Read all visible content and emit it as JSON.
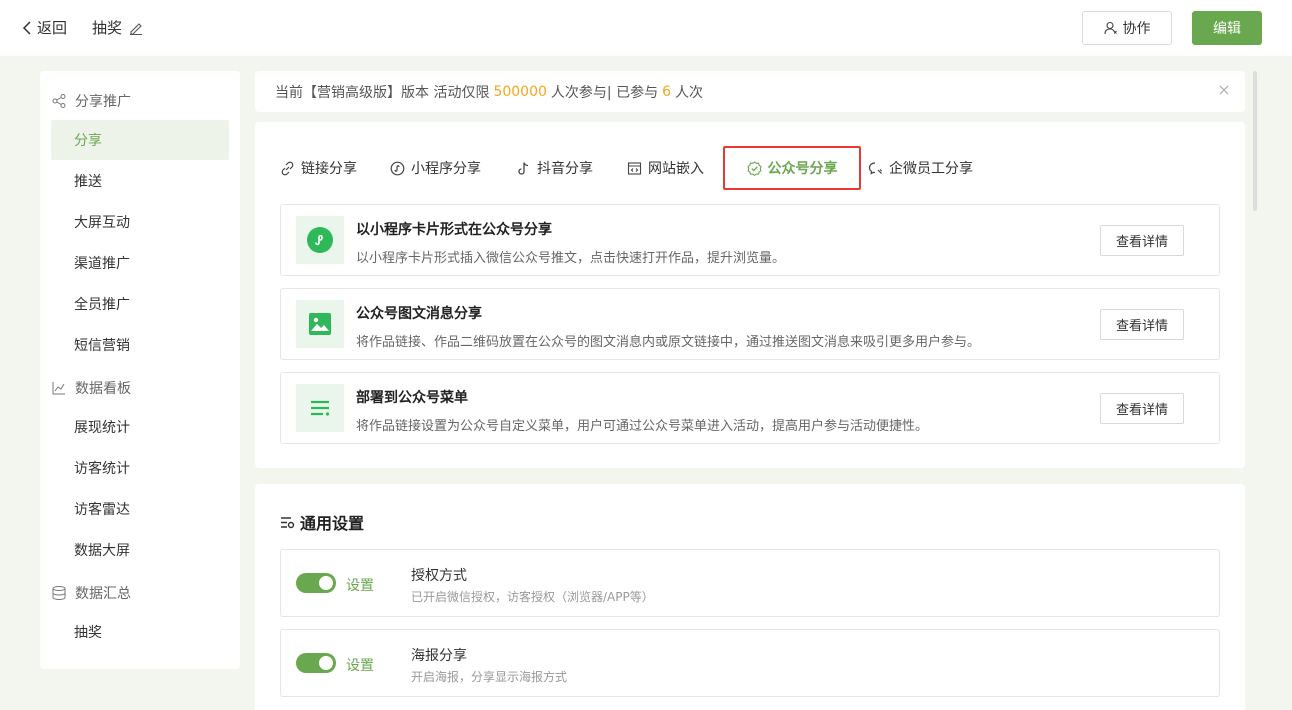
{
  "header": {
    "back_label": "返回",
    "title": "抽奖",
    "collab_label": "协作",
    "edit_label": "编辑"
  },
  "sidebar": {
    "groups": [
      {
        "label": "分享推广",
        "icon": "share-icon",
        "items": [
          "分享",
          "推送",
          "大屏互动",
          "渠道推广",
          "全员推广",
          "短信营销"
        ]
      },
      {
        "label": "数据看板",
        "icon": "chart-icon",
        "items": [
          "展现统计",
          "访客统计",
          "访客雷达",
          "数据大屏"
        ]
      },
      {
        "label": "数据汇总",
        "icon": "database-icon",
        "items": [
          "抽奖"
        ]
      }
    ],
    "active": "分享"
  },
  "notice": {
    "prefix": "当前【营销高级版】版本 活动仅限",
    "limit": "500000",
    "middle": "人次参与| 已参与",
    "count": "6",
    "suffix": "人次"
  },
  "tabs": [
    {
      "label": "链接分享",
      "icon": "link-icon"
    },
    {
      "label": "小程序分享",
      "icon": "miniprogram-icon"
    },
    {
      "label": "抖音分享",
      "icon": "douyin-icon"
    },
    {
      "label": "网站嵌入",
      "icon": "embed-icon"
    },
    {
      "label": "公众号分享",
      "icon": "verified-icon",
      "active": true
    },
    {
      "label": "企微员工分享",
      "icon": "wecom-icon"
    }
  ],
  "cards": [
    {
      "title": "以小程序卡片形式在公众号分享",
      "desc": "以小程序卡片形式插入微信公众号推文，点击快速打开作品，提升浏览量。",
      "button": "查看详情",
      "icon": "miniprogram-circle-icon"
    },
    {
      "title": "公众号图文消息分享",
      "desc": "将作品链接、作品二维码放置在公众号的图文消息内或原文链接中，通过推送图文消息来吸引更多用户参与。",
      "button": "查看详情",
      "icon": "image-icon"
    },
    {
      "title": "部署到公众号菜单",
      "desc": "将作品链接设置为公众号自定义菜单，用户可通过公众号菜单进入活动，提高用户参与活动便捷性。",
      "button": "查看详情",
      "icon": "menu-icon"
    }
  ],
  "settings": {
    "title": "通用设置",
    "rows": [
      {
        "link": "设置",
        "title": "授权方式",
        "desc": "已开启微信授权，访客授权（浏览器/APP等）",
        "enabled": true
      },
      {
        "link": "设置",
        "title": "海报分享",
        "desc": "开启海报，分享显示海报方式",
        "enabled": true
      }
    ]
  },
  "colors": {
    "accent": "#6aa84f",
    "highlight": "#f5a623",
    "tab_outline": "#e53935"
  }
}
